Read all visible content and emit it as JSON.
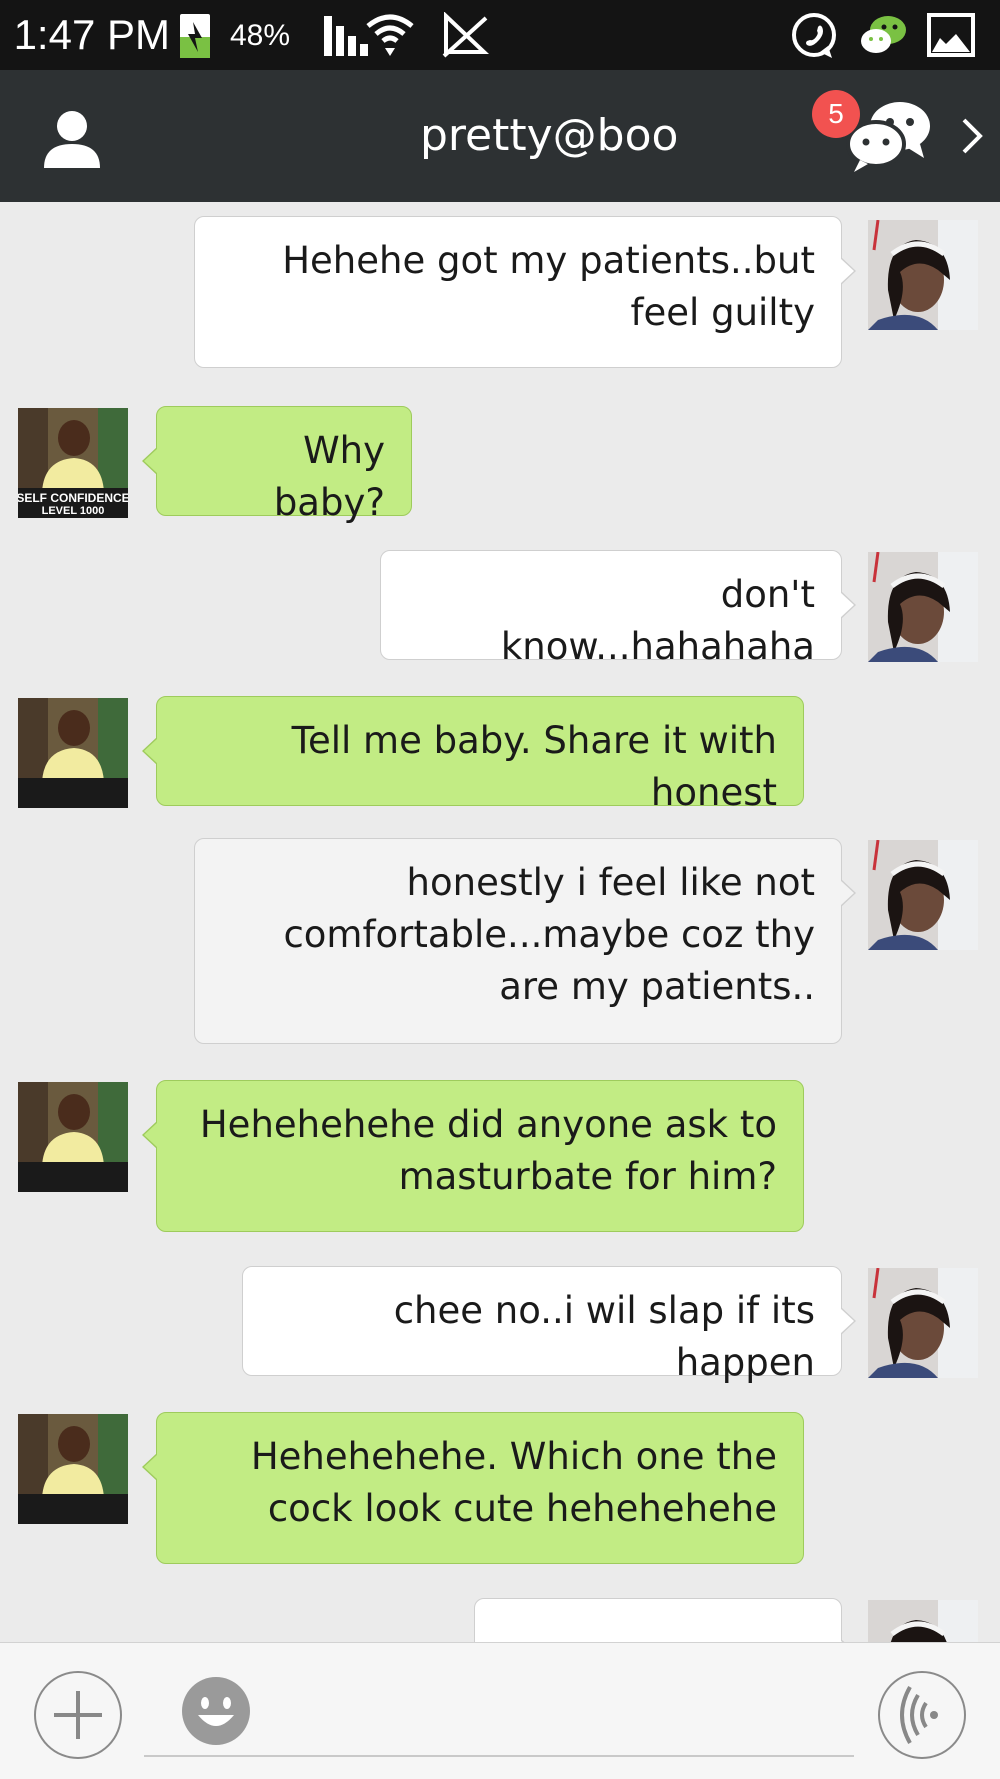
{
  "status_bar": {
    "time": "1:47 PM",
    "battery_percent": "48%",
    "battery_level": 0.48,
    "icons": [
      "battery-charging-icon",
      "signal-icon",
      "wifi-icon",
      "no-sim-icon",
      "whatsapp-icon",
      "wechat-icon",
      "gallery-icon"
    ]
  },
  "header": {
    "title": "pretty@boo",
    "unread_badge": "5",
    "icons": [
      "back-chevron-icon",
      "chats-icon",
      "contact-profile-icon"
    ]
  },
  "messages": [
    {
      "side": "received",
      "text": "Hehehe got my patients..but feel guilty",
      "avatar": "contact-avatar"
    },
    {
      "side": "sent",
      "text": "Why baby?",
      "avatar": "self-avatar"
    },
    {
      "side": "received",
      "text": "don't know...hahahaha",
      "avatar": "contact-avatar"
    },
    {
      "side": "sent",
      "text": "Tell me baby. Share it with honest",
      "avatar": "self-avatar"
    },
    {
      "side": "received",
      "text": "honestly i feel like not comfortable...maybe coz thy are my patients..",
      "avatar": "contact-avatar"
    },
    {
      "side": "sent",
      "text": "Hehehehehe did anyone ask to masturbate for him?",
      "avatar": "self-avatar"
    },
    {
      "side": "received",
      "text": "chee no..i wil slap if its happen",
      "avatar": "contact-avatar"
    },
    {
      "side": "sent",
      "text": "Hehehehehe. Which one the cock look cute hehehehehe",
      "avatar": "self-avatar"
    },
    {
      "side": "received",
      "text": "",
      "avatar": "contact-avatar"
    }
  ],
  "self_avatar_caption": [
    "SELF CONFIDENCE",
    "LEVEL 1000"
  ],
  "input_bar": {
    "icons": [
      "voice-icon",
      "emoji-icon",
      "add-icon"
    ]
  },
  "colors": {
    "status_bar_bg": "#141414",
    "header_bg": "#2d3133",
    "chat_bg": "#ebebeb",
    "sent_bubble": "#c2ec84",
    "received_bubble": "#ffffff",
    "badge": "#f25250"
  }
}
